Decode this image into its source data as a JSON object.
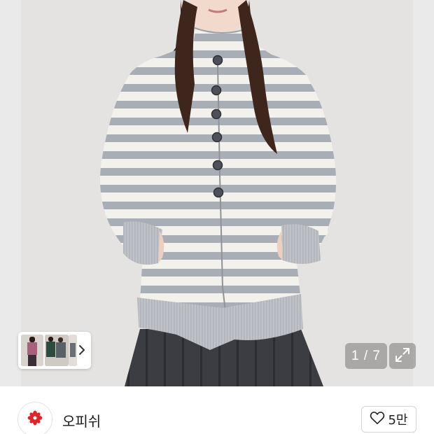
{
  "gallery": {
    "current_page": "1",
    "total_pages": "7",
    "counter_text": "1 / 7",
    "image_subject": "striped-zip-jacket-photo",
    "thumbnails": [
      "thumbnail-1",
      "thumbnail-2",
      "thumbnail-3"
    ]
  },
  "shop": {
    "name": "오피쉬",
    "logo_icon": "flower-icon",
    "logo_color": "#e0262c"
  },
  "like": {
    "icon": "heart-outline-icon",
    "count": "5만"
  },
  "colors": {
    "stripe_gray": "#a9aeb6",
    "stripe_cream": "#f3f1ec",
    "skirt": "#3c3d42",
    "background": "#e8e8e8"
  }
}
